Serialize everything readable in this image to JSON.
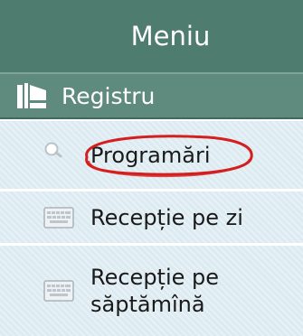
{
  "menu": {
    "title": "Meniu",
    "section": {
      "label": "Registru",
      "icon": "register-book-icon"
    },
    "items": [
      {
        "label": "Programări",
        "icon": "search-icon",
        "highlighted": true
      },
      {
        "label": "Recepție pe zi",
        "icon": "keyboard-icon"
      },
      {
        "label": "Recepție pe\nsăptămînă",
        "icon": "keyboard-icon"
      }
    ],
    "colors": {
      "header": "#4e7c6e",
      "section": "#5e8b7d",
      "item_background": "#dceaf1",
      "highlight": "#d41f1f"
    }
  }
}
